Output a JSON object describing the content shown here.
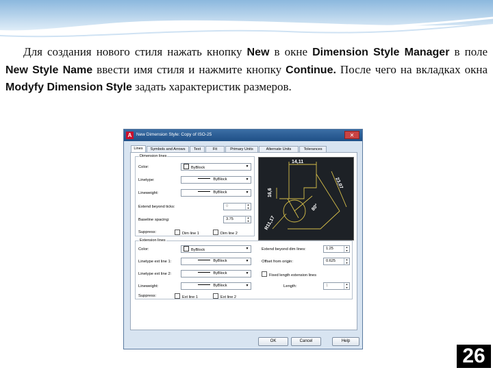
{
  "paragraph": {
    "p1": "Для создания нового стиля нажать кнопку ",
    "b1": "New",
    "p2": " в окне ",
    "b2": "Dimension Style Manager",
    "p3": " в поле ",
    "b3": "New Style Name",
    "p4": " ввести имя стиля и нажмите кнопку ",
    "b4": "Continue.",
    "p5": " После чего на вкладках окна ",
    "b5": "Modyfy Dimension Style",
    "p6": " задать характеристик размеров."
  },
  "page_number": "26",
  "dialog": {
    "title": "New Dimension Style: Copy of ISO-25",
    "app_icon": "A",
    "tabs": [
      {
        "label": "Lines",
        "active": true
      },
      {
        "label": "Symbols and Arrows"
      },
      {
        "label": "Text"
      },
      {
        "label": "Fit"
      },
      {
        "label": "Primary Units"
      },
      {
        "label": "Alternate Units"
      },
      {
        "label": "Tolerances"
      }
    ],
    "dim_lines": {
      "title": "Dimension lines",
      "color_label": "Color:",
      "color_value": "ByBlock",
      "linetype_label": "Linetype:",
      "linetype_value": "ByBlock",
      "lineweight_label": "Lineweight:",
      "lineweight_value": "ByBlock",
      "extend_label": "Extend beyond ticks:",
      "extend_value": "0",
      "baseline_label": "Baseline spacing:",
      "baseline_value": "3.75",
      "suppress_label": "Suppress:",
      "dimline1": "Dim line 1",
      "dimline2": "Dim line 2"
    },
    "ext_lines": {
      "title": "Extension lines",
      "color_label": "Color:",
      "color_value": "ByBlock",
      "lt1_label": "Linetype ext line 1:",
      "lt1_value": "ByBlock",
      "lt2_label": "Linetype ext line 2:",
      "lt2_value": "ByBlock",
      "lineweight_label": "Lineweight:",
      "lineweight_value": "ByBlock",
      "suppress_label": "Suppress:",
      "extline1": "Ext line 1",
      "extline2": "Ext line 2",
      "extend_label": "Extend beyond dim lines:",
      "extend_value": "1.25",
      "offset_label": "Offset from origin:",
      "offset_value": "0.625",
      "fixed_label": "Fixed length extension lines",
      "length_label": "Length:",
      "length_value": "1"
    },
    "preview": {
      "d1": "14,11",
      "d2": "16,6",
      "d3": "23,07",
      "d4": "R11,17",
      "d5": "80°"
    },
    "buttons": {
      "ok": "OK",
      "cancel": "Cancel",
      "help": "Help"
    }
  },
  "colors": {
    "header_blue": "#6fa3cf",
    "titlebar": "#2d5f97",
    "preview_bg": "#1d2126",
    "preview_yellow": "#d8c04a"
  }
}
